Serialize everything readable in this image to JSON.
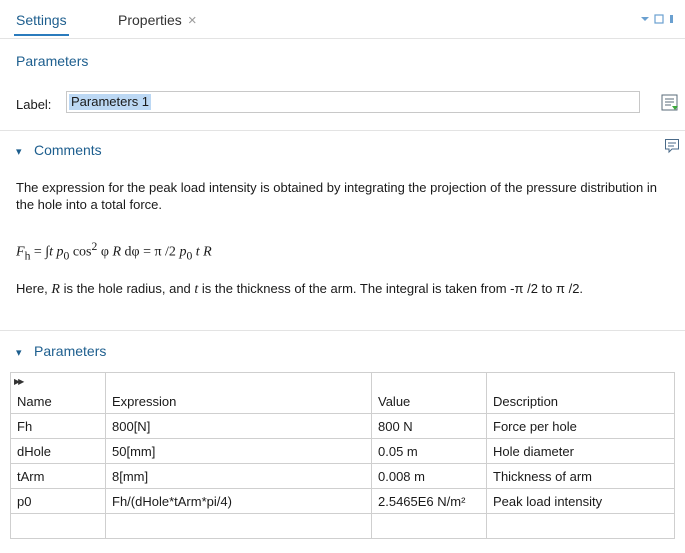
{
  "tabs": [
    {
      "label": "Settings"
    },
    {
      "label": "Properties",
      "close": "×"
    }
  ],
  "section_title": "Parameters",
  "label_field": {
    "label": "Label:",
    "value": "Parameters 1"
  },
  "comments": {
    "header": "Comments",
    "para1": "The expression for the peak load intensity is obtained by integrating the projection of the pressure distribution in the hole into a total force.",
    "formula": {
      "lhs": "F",
      "lhs_sub": "h",
      "eq": " = ∫",
      "t1": "t",
      "p0a": "p",
      "p0a_sub": "0",
      "cos": " cos",
      "sq": "2",
      "phi": " φ ",
      "R1": "R",
      "dphi": " dφ = π /2 ",
      "p0b": "p",
      "p0b_sub": "0",
      "t2": " t",
      "R2": " R"
    },
    "para2_a": "Here, ",
    "para2_R": "R",
    "para2_b": " is the hole radius, and ",
    "para2_t": "t",
    "para2_c": " is the thickness of the arm. The integral is taken from -π /2 to π /2."
  },
  "parameters": {
    "header": "Parameters",
    "columns": [
      "Name",
      "Expression",
      "Value",
      "Description"
    ],
    "rows": [
      {
        "name": "Fh",
        "expression": "800[N]",
        "value": "800 N",
        "description": "Force per hole"
      },
      {
        "name": "dHole",
        "expression": "50[mm]",
        "value": "0.05 m",
        "description": "Hole diameter"
      },
      {
        "name": "tArm",
        "expression": "8[mm]",
        "value": "0.008 m",
        "description": "Thickness of arm"
      },
      {
        "name": "p0",
        "expression": "Fh/(dHole*tArm*pi/4)",
        "value": "2.5465E6 N/m²",
        "description": "Peak load intensity"
      },
      {
        "name": "",
        "expression": "",
        "value": "",
        "description": ""
      }
    ]
  },
  "colors": {
    "accent": "#1d5e8e",
    "selection": "#bcd8f4"
  }
}
